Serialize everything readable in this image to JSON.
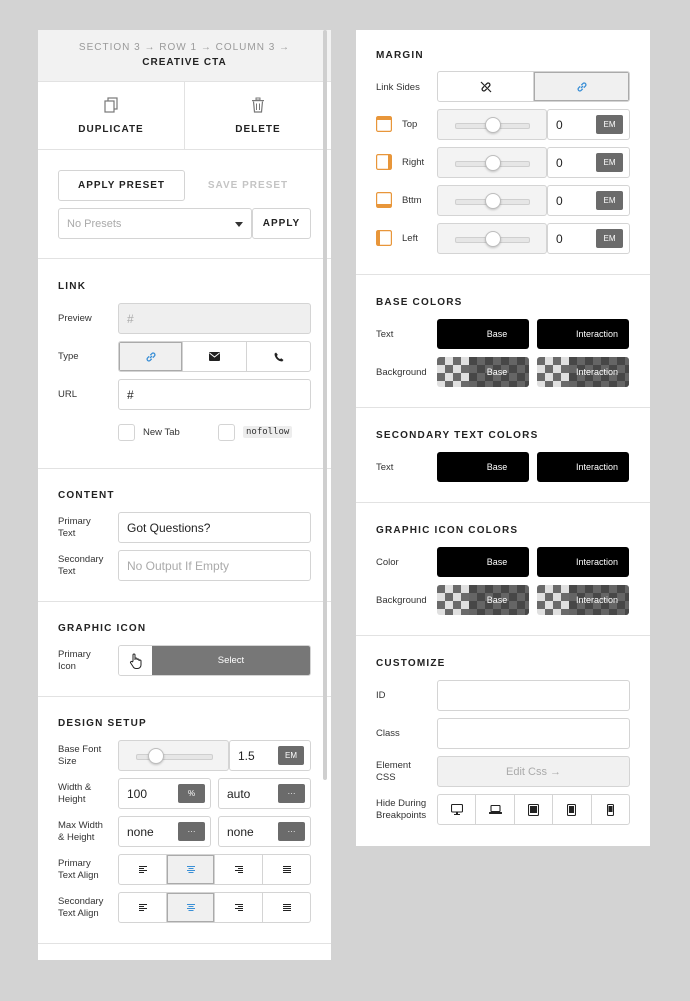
{
  "left": {
    "breadcrumb": "SECTION 3 → ROW 1 → COLUMN 3 →",
    "element_title": "CREATIVE CTA",
    "actions": {
      "duplicate": "DUPLICATE",
      "delete": "DELETE"
    },
    "presets": {
      "apply_preset": "APPLY PRESET",
      "save_preset": "SAVE PRESET",
      "select_value": "No Presets",
      "apply": "APPLY"
    },
    "link": {
      "title": "LINK",
      "preview_label": "Preview",
      "preview_value": "#",
      "type_label": "Type",
      "type_options": [
        "link-icon",
        "envelope-icon",
        "phone-icon"
      ],
      "type_selected": 0,
      "url_label": "URL",
      "url_value": "#",
      "new_tab": "New Tab",
      "nofollow": "nofollow"
    },
    "content": {
      "title": "CONTENT",
      "primary_label_1": "Primary",
      "primary_label_2": "Text",
      "primary_value": "Got Questions?",
      "secondary_label_1": "Secondary",
      "secondary_label_2": "Text",
      "secondary_placeholder": "No Output If Empty"
    },
    "graphic_icon": {
      "title": "GRAPHIC ICON",
      "label_1": "Primary",
      "label_2": "Icon",
      "select": "Select"
    },
    "design_setup": {
      "title": "DESIGN SETUP",
      "base_font_1": "Base Font",
      "base_font_2": "Size",
      "base_font_value": "1.5",
      "base_font_unit": "EM",
      "base_font_slider": 0.25,
      "wh_1": "Width &",
      "wh_2": "Height",
      "width_value": "100",
      "width_unit": "%",
      "height_value": "auto",
      "height_unit": "···",
      "mwh_1": "Max Width",
      "mwh_2": "& Height",
      "max_width_value": "none",
      "max_width_unit": "···",
      "max_height_value": "none",
      "max_height_unit": "···",
      "pta_1": "Primary",
      "pta_2": "Text Align",
      "sta_1": "Secondary",
      "sta_2": "Text Align",
      "align_selected": 1
    }
  },
  "right": {
    "margin": {
      "title": "MARGIN",
      "link_sides": "Link Sides",
      "link_selected": 1,
      "rows": [
        {
          "label": "Top",
          "value": "0",
          "unit": "EM",
          "slider": 0.5
        },
        {
          "label": "Right",
          "value": "0",
          "unit": "EM",
          "slider": 0.5
        },
        {
          "label": "Bttm",
          "value": "0",
          "unit": "EM",
          "slider": 0.5
        },
        {
          "label": "Left",
          "value": "0",
          "unit": "EM",
          "slider": 0.5
        }
      ]
    },
    "base_colors": {
      "title": "BASE COLORS",
      "text_label": "Text",
      "bg_label": "Background",
      "base": "Base",
      "interaction": "Interaction"
    },
    "secondary_text_colors": {
      "title": "SECONDARY TEXT COLORS",
      "text_label": "Text",
      "base": "Base",
      "interaction": "Interaction"
    },
    "graphic_icon_colors": {
      "title": "GRAPHIC ICON COLORS",
      "color_label": "Color",
      "bg_label": "Background",
      "base": "Base",
      "interaction": "Interaction"
    },
    "customize": {
      "title": "CUSTOMIZE",
      "id_label": "ID",
      "class_label": "Class",
      "css_1": "Element",
      "css_2": "CSS",
      "edit_css": "Edit Css →",
      "hide_1": "Hide During",
      "hide_2": "Breakpoints",
      "breakpoints": [
        "desktop-icon",
        "laptop-icon",
        "tablet-landscape-icon",
        "tablet-portrait-icon",
        "phone-icon"
      ]
    }
  },
  "colors": {
    "accent": "#3a8fd6",
    "margin_icon": "#e8963a",
    "swatch": "#000000",
    "unit_bg": "#6b6b6b"
  }
}
